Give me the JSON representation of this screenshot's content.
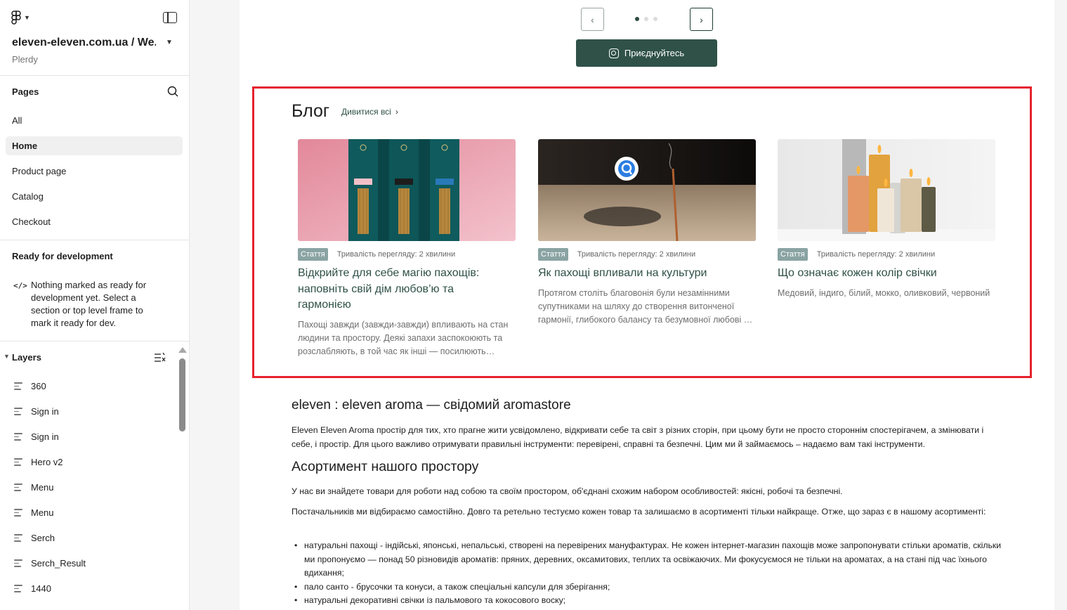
{
  "sidebar": {
    "file_name": "eleven-eleven.com.ua / We...",
    "team_name": "Plerdy",
    "pages_title": "Pages",
    "pages": [
      {
        "label": "All"
      },
      {
        "label": "Home"
      },
      {
        "label": "Product page"
      },
      {
        "label": "Catalog"
      },
      {
        "label": "Checkout"
      }
    ],
    "active_page": "Home",
    "dev_title": "Ready for development",
    "dev_text": "Nothing marked as ready for development yet. Select a section or top level frame to mark it ready for dev.",
    "layers_title": "Layers",
    "layers": [
      {
        "label": "360"
      },
      {
        "label": "Sign in"
      },
      {
        "label": "Sign in"
      },
      {
        "label": "Hero v2"
      },
      {
        "label": "Menu"
      },
      {
        "label": "Menu"
      },
      {
        "label": "Serch"
      },
      {
        "label": "Serch_Result"
      },
      {
        "label": "1440"
      }
    ]
  },
  "carousel": {
    "prev_icon": "chevron-left-icon",
    "next_icon": "chevron-right-icon",
    "dots": 3,
    "active_dot": 1
  },
  "join_button": {
    "label": "Приєднуйтесь",
    "icon": "instagram-icon"
  },
  "blog": {
    "title": "Блог",
    "view_all": "Дивитися всі",
    "cards": [
      {
        "tag": "Стаття",
        "duration": "Тривалість перегляду: 2 хвилини",
        "title": "Відкрийте для себе магію пахощів: наповніть свій дім любов’ю та гармонією",
        "description": "Пахощі завжди (завжди-завжди) впливають на стан людини та простору. Деякі запахи заспокоюють та розслабляють, в той час як інші — посилюють концентрацію."
      },
      {
        "tag": "Стаття",
        "duration": "Тривалість перегляду: 2 хвилини",
        "title": "Як пахощі впливали на культури",
        "description": "Протягом століть благовонія були незамінними супутниками на шляху до створення витонченої гармонії, глибокого балансу та безумовної любові до себе."
      },
      {
        "tag": "Стаття",
        "duration": "Тривалість перегляду: 2 хвилини",
        "title": "Що означає кожен колір свічки",
        "description": "Медовий, індиго, білий, мокко, оливковий, червоний"
      }
    ]
  },
  "about": {
    "heading": "eleven : eleven aroma — свідомий aromastore",
    "text": "Eleven Eleven Aroma простір для тих, хто прагне жити усвідомлено, відкривати себе та світ з різних сторін, при цьому бути не просто стороннім спостерігачем, а змінювати і себе, і простір. Для цього важливо отримувати правильні інструменти: перевірені, справні та безпечні. Цим ми й займаємось – надаємо вам такі інструменти."
  },
  "assortment": {
    "heading": "Асортимент нашого простору",
    "p1": "У нас ви знайдете товари для роботи над собою та своїм простором, об'єднані схожим набором особливостей: якісні, робочі та безпечні.",
    "p2": "Постачальників ми відбираємо самостійно. Довго та ретельно тестуємо кожен товар та залишаємо в асортименті тільки найкраще. Отже, що зараз є в нашому асортименті:",
    "bullets": [
      "натуральні пахощі - індійські, японські, непальські, створені на перевірених мануфактурах. Не кожен інтернет-магазин пахощів може запропонувати стільки ароматів, скільки ми пропонуємо — понад 50 різновидів ароматів: пряних, деревних, оксамитових, теплих та освіжаючих. Ми фокусуємося не тільки на ароматах, а на стані під час їхнього вдихання;",
      "пало санто - брусочки та конуси, а також спеціальні капсули для зберігання;",
      "натуральні декоративні свічки із пальмового та кокосового воску;"
    ]
  },
  "colors": {
    "brand_green": "#2f5148",
    "highlight_red": "#e6222f",
    "tag_bg": "#8aa3a3"
  }
}
